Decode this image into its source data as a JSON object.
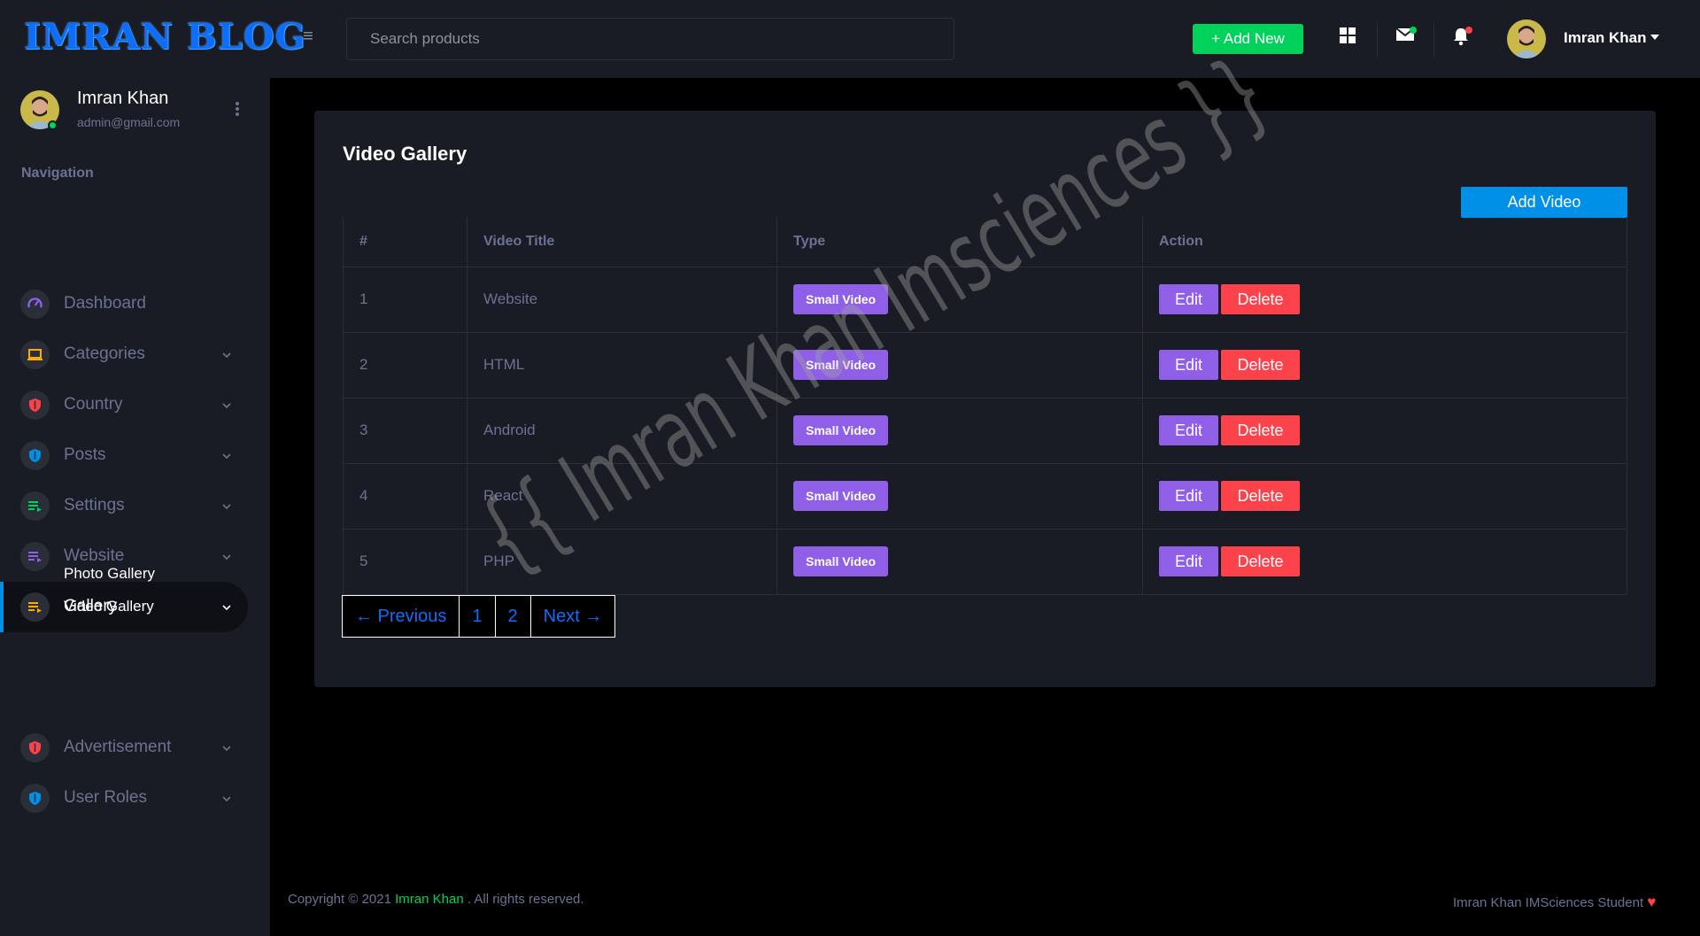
{
  "header": {
    "logo": "IMRAN BLOG",
    "search_placeholder": "Search products",
    "add_new_label": "+ Add New",
    "username": "Imran Khan"
  },
  "sidebar": {
    "profile": {
      "name": "Imran Khan",
      "email": "admin@gmail.com"
    },
    "heading": "Navigation",
    "items": [
      {
        "label": "Dashboard",
        "icon": "speedometer-icon",
        "color": "#8f5fe8",
        "expandable": false
      },
      {
        "label": "Categories",
        "icon": "laptop-icon",
        "color": "#ffab00",
        "expandable": true
      },
      {
        "label": "Country",
        "icon": "security-shield-icon",
        "color": "#fc424a",
        "expandable": true
      },
      {
        "label": "Posts",
        "icon": "security-shield-icon",
        "color": "#0090e7",
        "expandable": true
      },
      {
        "label": "Settings",
        "icon": "playlist-icon",
        "color": "#00d25b",
        "expandable": true
      },
      {
        "label": "Website",
        "icon": "playlist-icon",
        "color": "#8f5fe8",
        "expandable": true
      },
      {
        "label": "Gallery",
        "icon": "playlist-icon",
        "color": "#ffab00",
        "expandable": true,
        "active": true
      },
      {
        "label": "Advertisement",
        "icon": "security-shield-icon",
        "color": "#fc424a",
        "expandable": true
      },
      {
        "label": "User Roles",
        "icon": "security-shield-icon",
        "color": "#0090e7",
        "expandable": true
      }
    ],
    "gallery_sub": [
      "Photo Gallery",
      "Video Gallery"
    ]
  },
  "main": {
    "title": "Video Gallery",
    "add_button": "Add Video",
    "columns": [
      "#",
      "Video Title",
      "Type",
      "Action"
    ],
    "rows": [
      {
        "num": "1",
        "title": "Website",
        "type": "Small Video"
      },
      {
        "num": "2",
        "title": "HTML",
        "type": "Small Video"
      },
      {
        "num": "3",
        "title": "Android",
        "type": "Small Video"
      },
      {
        "num": "4",
        "title": "React",
        "type": "Small Video"
      },
      {
        "num": "5",
        "title": "PHP",
        "type": "Small Video"
      }
    ],
    "edit_label": "Edit",
    "delete_label": "Delete",
    "pagination": {
      "prev": "← Previous",
      "pages": [
        "1",
        "2"
      ],
      "next": "Next →"
    }
  },
  "watermark": "{{ Imran Khan Imsciences }}",
  "footer": {
    "copyright_prefix": "Copyright © 2021",
    "copyright_name": "Imran Khan",
    "copyright_suffix": ". All rights reserved.",
    "right_text": "Imran Khan IMSciences Student"
  }
}
